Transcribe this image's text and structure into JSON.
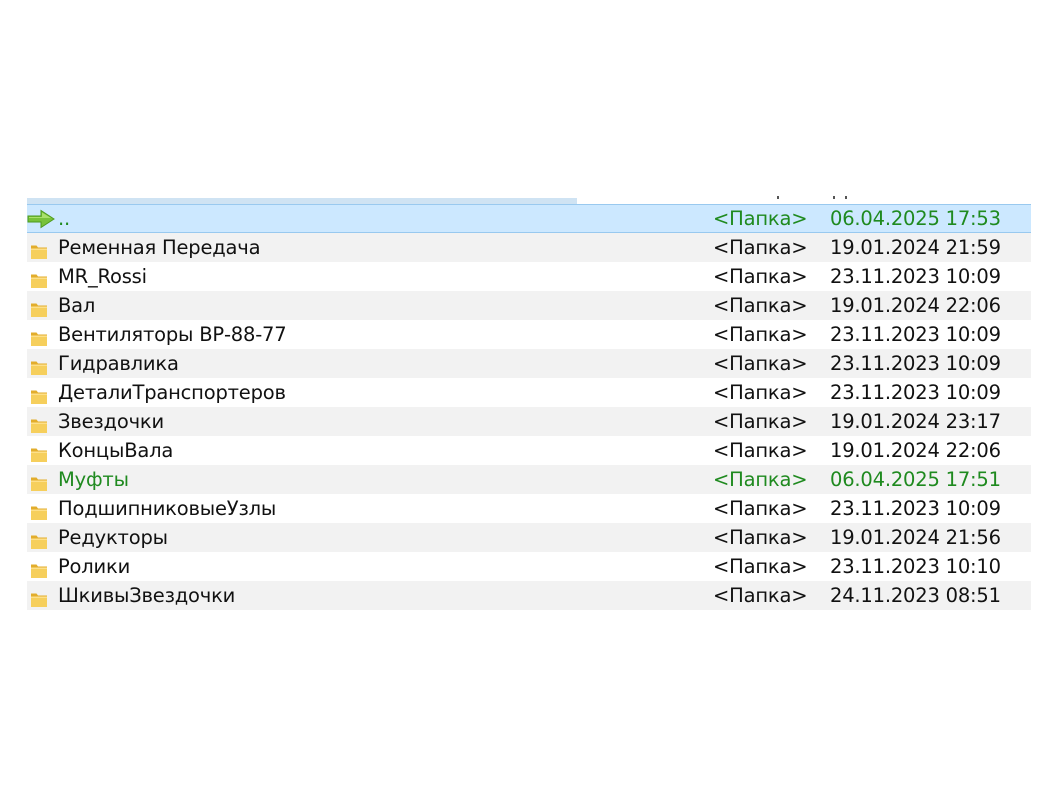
{
  "colors": {
    "selected_bg": "#cce8ff",
    "alt_row_bg": "#f2f2f2",
    "highlight_text": "#1f8a1f",
    "folder_icon": "#f3c64a"
  },
  "rows": [
    {
      "name": "..",
      "type": "<Папка>",
      "date": "06.04.2025 17:53",
      "icon": "up-arrow-icon",
      "selected": true,
      "highlight": true
    },
    {
      "name": " Ременная Передача",
      "type": "<Папка>",
      "date": "19.01.2024 21:59",
      "icon": "folder-icon"
    },
    {
      "name": "MR_Rossi",
      "type": "<Папка>",
      "date": "23.11.2023 10:09",
      "icon": "folder-icon"
    },
    {
      "name": "Вал",
      "type": "<Папка>",
      "date": "19.01.2024 22:06",
      "icon": "folder-icon"
    },
    {
      "name": "Вентиляторы ВР-88-77",
      "type": "<Папка>",
      "date": "23.11.2023 10:09",
      "icon": "folder-icon"
    },
    {
      "name": "Гидравлика",
      "type": "<Папка>",
      "date": "23.11.2023 10:09",
      "icon": "folder-icon"
    },
    {
      "name": "ДеталиТранспортеров",
      "type": "<Папка>",
      "date": "23.11.2023 10:09",
      "icon": "folder-icon"
    },
    {
      "name": "Звездочки",
      "type": "<Папка>",
      "date": "19.01.2024 23:17",
      "icon": "folder-icon"
    },
    {
      "name": "КонцыВала",
      "type": "<Папка>",
      "date": "19.01.2024 22:06",
      "icon": "folder-icon"
    },
    {
      "name": "Муфты",
      "type": "<Папка>",
      "date": "06.04.2025 17:51",
      "icon": "folder-icon",
      "highlight": true
    },
    {
      "name": "ПодшипниковыеУзлы",
      "type": "<Папка>",
      "date": "23.11.2023 10:09",
      "icon": "folder-icon"
    },
    {
      "name": "Редукторы",
      "type": "<Папка>",
      "date": "19.01.2024 21:56",
      "icon": "folder-icon"
    },
    {
      "name": "Ролики",
      "type": "<Папка>",
      "date": "23.11.2023 10:10",
      "icon": "folder-icon"
    },
    {
      "name": "ШкивыЗвездочки",
      "type": "<Папка>",
      "date": "24.11.2023 08:51",
      "icon": "folder-icon"
    }
  ]
}
